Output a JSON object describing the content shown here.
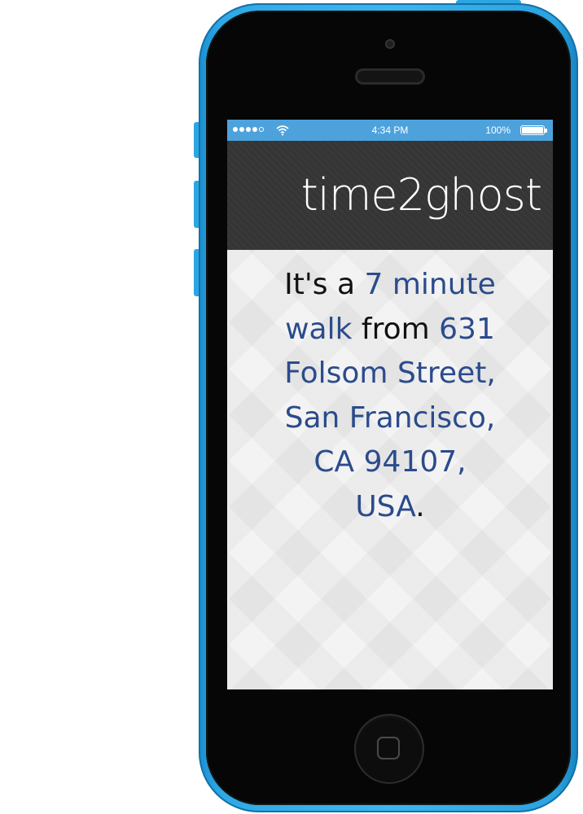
{
  "status_bar": {
    "time": "4:34 PM",
    "battery_percent": "100%",
    "signal_bars_filled": 4,
    "signal_bars_total": 5
  },
  "header": {
    "logo_text": "time2ghost"
  },
  "message": {
    "prefix": "It's a",
    "duration": "7 minute",
    "mode": "walk",
    "connector": "from",
    "address": "631 Folsom Street, San Francisco, CA 94107, USA",
    "suffix": "."
  },
  "colors": {
    "phone_body": "#2fa9e6",
    "status_bar": "#4ea2dc",
    "header_bg": "#353535",
    "highlight": "#2b4b8c",
    "text": "#111111"
  },
  "icons": [
    "wifi-icon",
    "battery-icon",
    "home-button-icon"
  ]
}
